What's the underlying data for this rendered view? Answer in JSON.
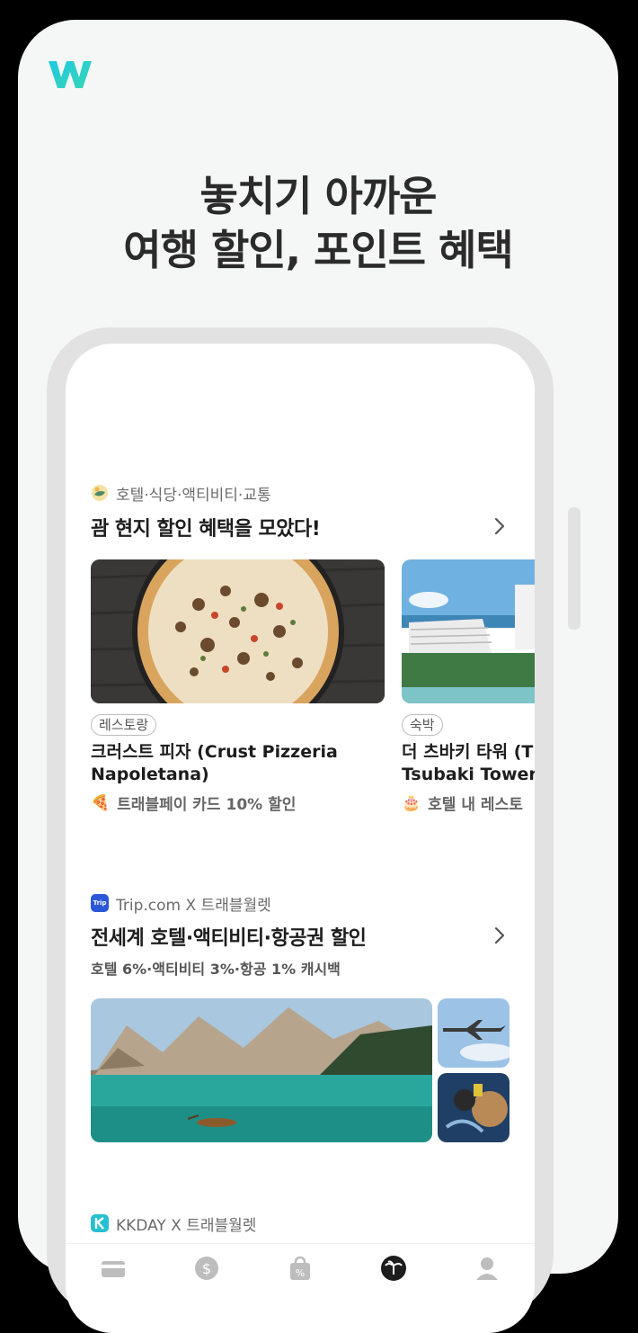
{
  "headline": {
    "line1": "놓치기 아까운",
    "line2": "여행 할인, 포인트 혜택"
  },
  "colors": {
    "brand": "#28c3d6",
    "accent": "#3b5bdb"
  },
  "section1": {
    "source": "호텔·식당·액티비티·교통",
    "title": "괌 현지 할인 혜택을 모았다!",
    "items": [
      {
        "tag": "레스토랑",
        "title_line1": "크러스트 피자 (Crust Pizzeria",
        "title_line2": "Napoletana)",
        "desc_emoji": "🍕",
        "desc": "트래블페이 카드 10% 할인"
      },
      {
        "tag": "숙박",
        "title_line1": "더 츠바키 타워 (T",
        "title_line2": "Tsubaki Tower",
        "desc_emoji": "🎂",
        "desc": "호텔 내 레스토"
      }
    ]
  },
  "section2": {
    "source_icon_text": "Trip",
    "source": "Trip.com X 트래블월렛",
    "title": "전세계 호텔·액티비티·항공권 할인",
    "subtitle": "호텔 6%·액티비티 3%·항공 1% 캐시백"
  },
  "section3": {
    "source": "KKDAY X 트래블월렛"
  },
  "tabbar": {
    "icons": [
      "card-icon",
      "dollar-icon",
      "discount-bag-icon",
      "palm-tree-icon",
      "profile-icon"
    ]
  }
}
